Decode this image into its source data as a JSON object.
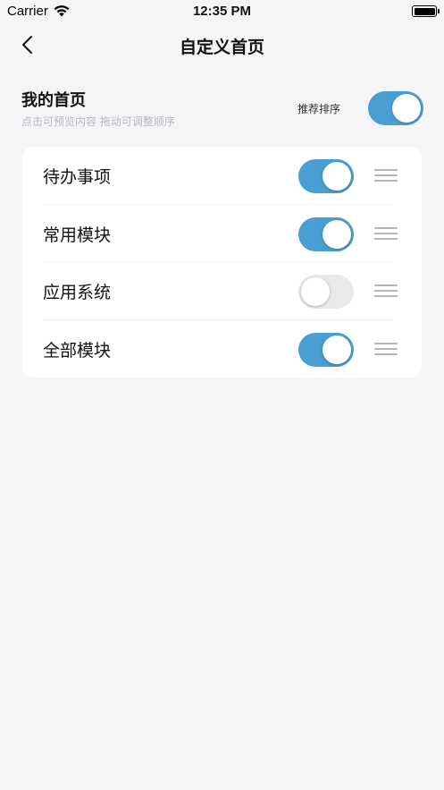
{
  "status_bar": {
    "carrier": "Carrier",
    "time": "12:35 PM"
  },
  "nav": {
    "title": "自定义首页",
    "back_icon": "chevron-left-icon"
  },
  "section": {
    "title": "我的首页",
    "subtitle": "点击可预览内容 拖动可调整顺序",
    "sort_label": "推荐排序",
    "sort_enabled": true
  },
  "modules": [
    {
      "label": "待办事项",
      "enabled": true
    },
    {
      "label": "常用模块",
      "enabled": true
    },
    {
      "label": "应用系统",
      "enabled": false
    },
    {
      "label": "全部模块",
      "enabled": true
    }
  ],
  "colors": {
    "accent": "#4a9fd2",
    "background": "#f5f5f8",
    "toggle_off": "#e9e9ec"
  }
}
